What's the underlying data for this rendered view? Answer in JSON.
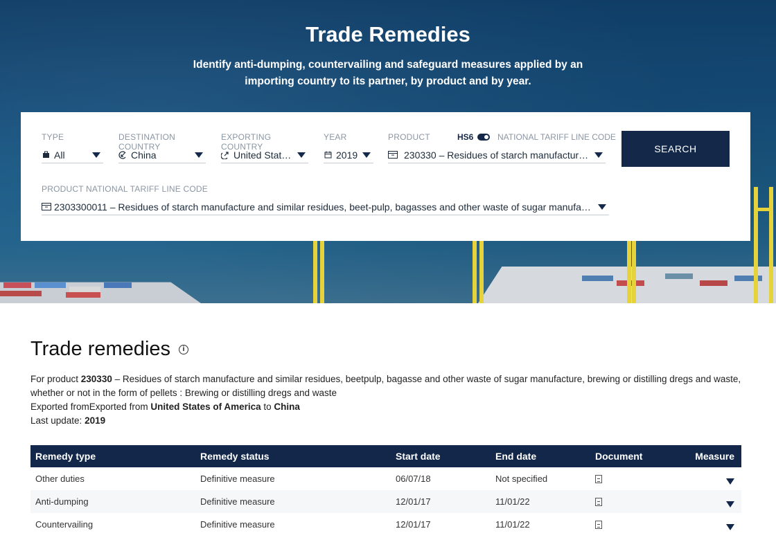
{
  "hero": {
    "title": "Trade Remedies",
    "subtitle": "Identify anti-dumping, countervailing and safeguard measures applied by an importing country to its partner, by product and by year."
  },
  "filters": {
    "type": {
      "label": "TYPE",
      "value": "All",
      "icon": "briefcase-icon"
    },
    "destination": {
      "label": "DESTINATION COUNTRY",
      "value": "China",
      "icon": "arrow-in-icon"
    },
    "exporting": {
      "label": "EXPORTING COUNTRY",
      "value": "United State…",
      "icon": "arrow-out-icon"
    },
    "year": {
      "label": "YEAR",
      "value": "2019",
      "icon": "calendar-icon"
    },
    "product": {
      "label": "PRODUCT",
      "value": "230330 – Residues of starch manufacture …",
      "icon": "box-icon"
    },
    "hs6_label": "HS6",
    "national_tariff_label": "NATIONAL TARIFF LINE CODE",
    "product_ntl": {
      "label": "PRODUCT NATIONAL TARIFF LINE CODE",
      "value": "2303300011 – Residues of starch manufacture and similar residues, beet-pulp, bagasses and other waste of sugar manufacture…",
      "icon": "box-icon"
    },
    "search_label": "SEARCH"
  },
  "results": {
    "title": "Trade remedies",
    "for_product_prefix": "For product ",
    "product_code": "230330",
    "product_desc": " – Residues of starch manufacture and similar residues, beetpulp, bagasse and other waste of sugar manufacture, brewing or distilling dregs and waste, whether or not in the form of pellets : Brewing or distilling dregs and waste",
    "exported_prefix": "Exported fromExported from ",
    "from_country": "United States of America",
    "to_text": " to ",
    "to_country": "China",
    "last_update_prefix": "Last update: ",
    "last_update_year": "2019"
  },
  "table": {
    "headers": [
      "Remedy type",
      "Remedy status",
      "Start date",
      "End date",
      "Document",
      "Measure"
    ],
    "rows": [
      {
        "type": "Other duties",
        "status": "Definitive measure",
        "start": "06/07/18",
        "end": "Not specified"
      },
      {
        "type": "Anti-dumping",
        "status": "Definitive measure",
        "start": "12/01/17",
        "end": "11/01/22"
      },
      {
        "type": "Countervailing",
        "status": "Definitive measure",
        "start": "12/01/17",
        "end": "11/01/22"
      }
    ]
  },
  "colors": {
    "navy": "#14294a",
    "header": "#12274a"
  }
}
